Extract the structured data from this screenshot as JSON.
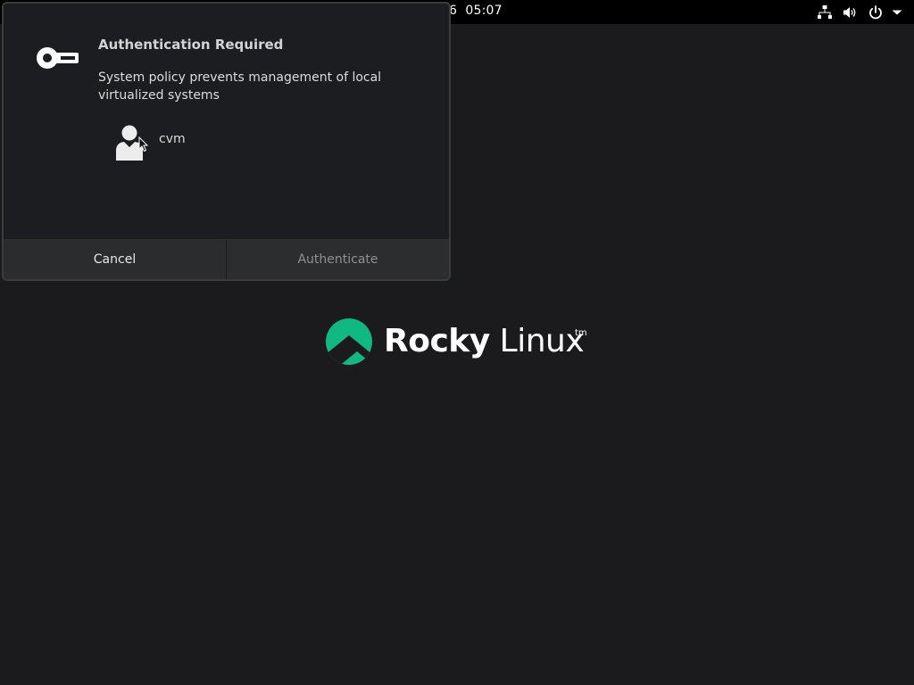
{
  "topbar": {
    "clock": "6  05:07",
    "icons": [
      "network-wired-icon",
      "volume-icon",
      "power-icon",
      "chevron-down-icon"
    ]
  },
  "dialog": {
    "title": "Authentication Required",
    "message": "System policy prevents management of local virtualized systems",
    "user": {
      "name": "cvm",
      "avatar_icon": "user-avatar-icon"
    },
    "icon": "key-icon",
    "buttons": {
      "cancel": "Cancel",
      "authenticate": "Authenticate"
    }
  },
  "branding": {
    "logo_bold": "Rocky",
    "logo_light": "Linux",
    "trademark": "tm",
    "accent_color": "#10b981"
  }
}
